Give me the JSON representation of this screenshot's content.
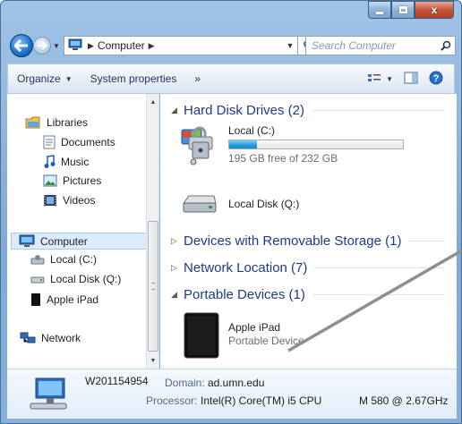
{
  "window": {
    "caption_buttons": {
      "minimize": "minimize",
      "maximize": "maximize",
      "close": "x"
    }
  },
  "address_bar": {
    "path": "Computer",
    "search_placeholder": "Search Computer"
  },
  "toolbar": {
    "organize": "Organize",
    "system_properties": "System properties",
    "more": "»"
  },
  "nav_pane": {
    "libraries": "Libraries",
    "documents": "Documents",
    "music": "Music",
    "pictures": "Pictures",
    "videos": "Videos",
    "computer": "Computer",
    "local_c": "Local (C:)",
    "local_disk_q": "Local Disk (Q:)",
    "apple_ipad": "Apple iPad",
    "network": "Network"
  },
  "content": {
    "groups": {
      "hard_disk": "Hard Disk Drives (2)",
      "removable": "Devices with Removable Storage (1)",
      "network_location": "Network Location (7)",
      "portable": "Portable Devices (1)"
    },
    "drive_c": {
      "name": "Local (C:)",
      "free_text": "195 GB free of 232 GB",
      "used_fraction": 0.16
    },
    "drive_q": {
      "name": "Local Disk (Q:)"
    },
    "ipad": {
      "name": "Apple iPad",
      "subtitle": "Portable Device"
    }
  },
  "details": {
    "computer_name": "W201154954",
    "domain_label": "Domain:",
    "domain_value": "ad.umn.edu",
    "processor_label": "Processor:",
    "processor_value": "Intel(R) Core(TM) i5 CPU",
    "processor_model": "M 580  @ 2.67GHz"
  },
  "colors": {
    "group_heading": "#1e3a8a",
    "usage_fill": "#26a0da",
    "selection": "#dcecfc"
  }
}
